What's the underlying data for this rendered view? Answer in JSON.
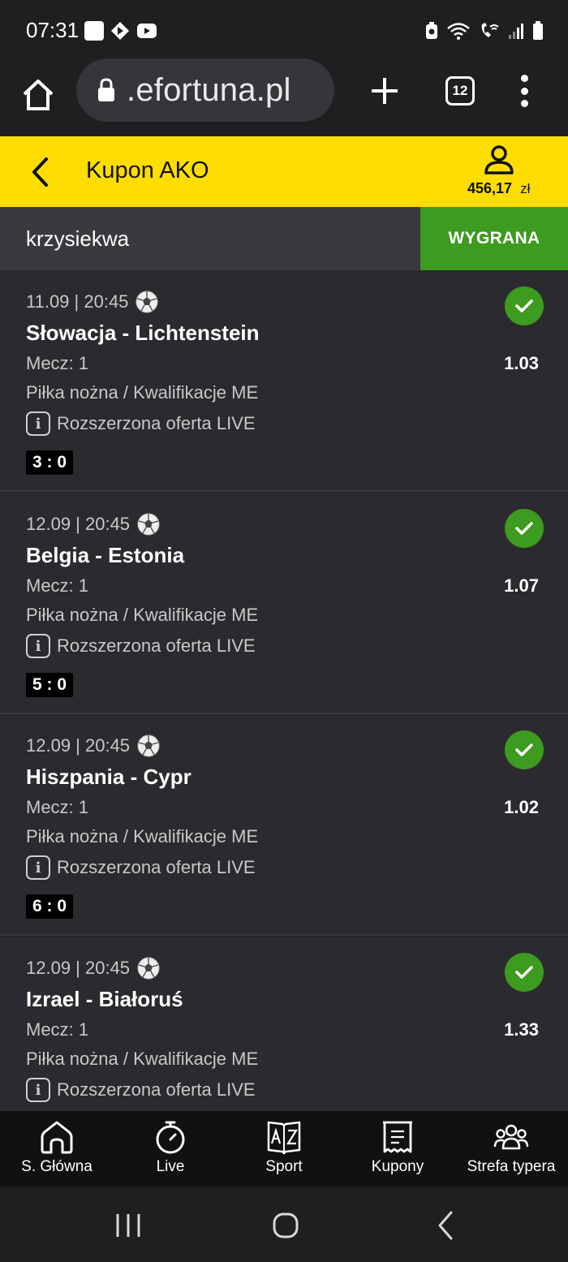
{
  "status_bar": {
    "time": "07:31",
    "left_icons": [
      "contact-icon",
      "app-icon",
      "youtube-icon"
    ],
    "right_icons": [
      "battery-saver-icon",
      "wifi-icon",
      "wifi-call-icon",
      "signal-icon",
      "battery-icon"
    ]
  },
  "browser": {
    "url": ".efortuna.pl",
    "tab_count": "12"
  },
  "header": {
    "title": "Kupon AKO",
    "balance": "456,17",
    "currency": "zł"
  },
  "coupon": {
    "username": "krzysiekwa",
    "status": "WYGRANA"
  },
  "bets": [
    {
      "datetime": "11.09 | 20:45",
      "match": "Słowacja - Lichtenstein",
      "pick": "Mecz: 1",
      "odds": "1.03",
      "league": "Piłka nożna / Kwalifikacje ME",
      "live_text": "Rozszerzona oferta LIVE",
      "score": "3 : 0"
    },
    {
      "datetime": "12.09 | 20:45",
      "match": "Belgia - Estonia",
      "pick": "Mecz: 1",
      "odds": "1.07",
      "league": "Piłka nożna / Kwalifikacje ME",
      "live_text": "Rozszerzona oferta LIVE",
      "score": "5 : 0"
    },
    {
      "datetime": "12.09 | 20:45",
      "match": "Hiszpania - Cypr",
      "pick": "Mecz: 1",
      "odds": "1.02",
      "league": "Piłka nożna / Kwalifikacje ME",
      "live_text": "Rozszerzona oferta LIVE",
      "score": "6 : 0"
    },
    {
      "datetime": "12.09 | 20:45",
      "match": "Izrael - Białoruś",
      "pick": "Mecz: 1",
      "odds": "1.33",
      "league": "Piłka nożna / Kwalifikacje ME",
      "live_text": "Rozszerzona oferta LIVE",
      "score": ""
    }
  ],
  "bottom_nav": [
    {
      "label": "S. Główna",
      "icon": "home-icon"
    },
    {
      "label": "Live",
      "icon": "stopwatch-icon"
    },
    {
      "label": "Sport",
      "icon": "az-book-icon"
    },
    {
      "label": "Kupony",
      "icon": "receipt-icon"
    },
    {
      "label": "Strefa typera",
      "icon": "group-icon"
    }
  ],
  "colors": {
    "brand_yellow": "#ffdd00",
    "win_green": "#3d9b1f",
    "card_bg": "#2b2b2f"
  }
}
